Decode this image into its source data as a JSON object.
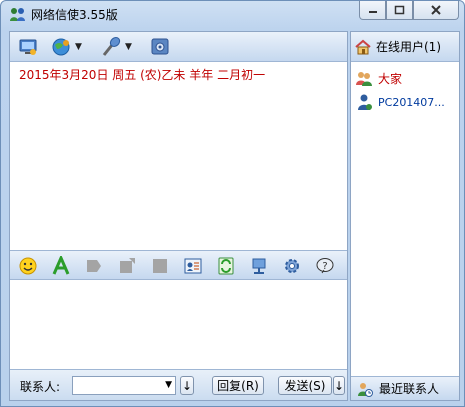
{
  "window": {
    "title": "网络信使3.55版"
  },
  "chat": {
    "date_line": "2015年3月20日  周五   (农)乙未 羊年 二月初一"
  },
  "bottom_bar": {
    "contact_label": "联系人:",
    "contact_value": "",
    "reply_label": "回复(R)",
    "send_label": "发送(S)"
  },
  "side": {
    "online_users_header": "在线用户(1)",
    "users": [
      {
        "name": "大家",
        "icon": "group-icon"
      },
      {
        "name": "PC201407...",
        "icon": "user-icon"
      }
    ],
    "recent_contacts": "最近联系人"
  },
  "colors": {
    "date_text": "#c00000",
    "panel_border": "#8ea5c4",
    "toolbar_gradient_top": "#eaf1fa",
    "toolbar_gradient_bottom": "#c5d8ef"
  },
  "icons": {
    "top_toolbar": [
      "monitor-icon",
      "globe-icon",
      "microphone-icon",
      "settings-window-icon"
    ],
    "mid_toolbar": [
      "smiley-icon",
      "font-icon",
      "forward-icon",
      "share-icon",
      "stop-icon",
      "contact-card-icon",
      "refresh-icon",
      "network-icon",
      "gear-icon",
      "help-icon"
    ]
  }
}
